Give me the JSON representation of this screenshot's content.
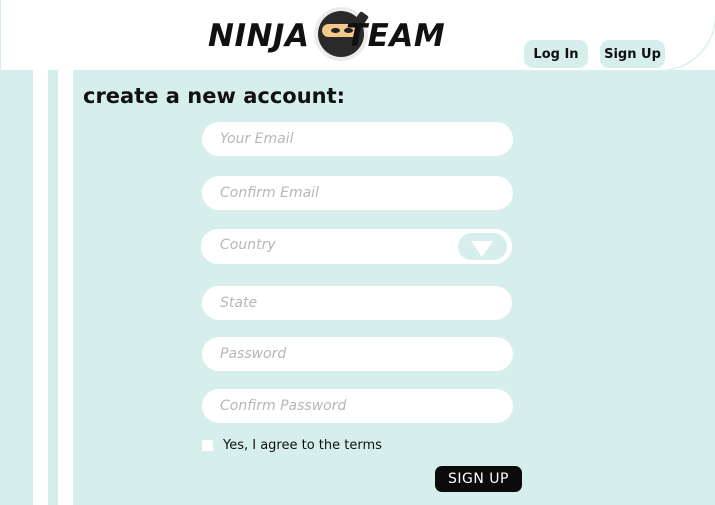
{
  "header": {
    "logo": {
      "word_left": "NINJA",
      "word_right": "TEAM",
      "icon": "ninja-face-icon"
    },
    "nav": {
      "login_label": "Log In",
      "signup_label": "Sign Up"
    }
  },
  "form": {
    "title": "create a new account:",
    "fields": {
      "email": {
        "placeholder": "Your Email",
        "value": ""
      },
      "confirm_email": {
        "placeholder": "Confirm Email",
        "value": ""
      },
      "country": {
        "placeholder": "Country",
        "value": "",
        "arrow_icon": "chevron-down-icon"
      },
      "state": {
        "placeholder": "State",
        "value": ""
      },
      "password": {
        "placeholder": "Password",
        "value": ""
      },
      "confirm_password": {
        "placeholder": "Confirm Password",
        "value": ""
      }
    },
    "terms_label": "Yes, I agree to the terms",
    "terms_checked": false,
    "submit_label": "SIGN UP"
  },
  "colors": {
    "accent": "#d6efed",
    "field_bg": "#ffffff",
    "button_dark": "#0b0b0b",
    "text": "#111111",
    "placeholder": "#b7b7b7"
  }
}
